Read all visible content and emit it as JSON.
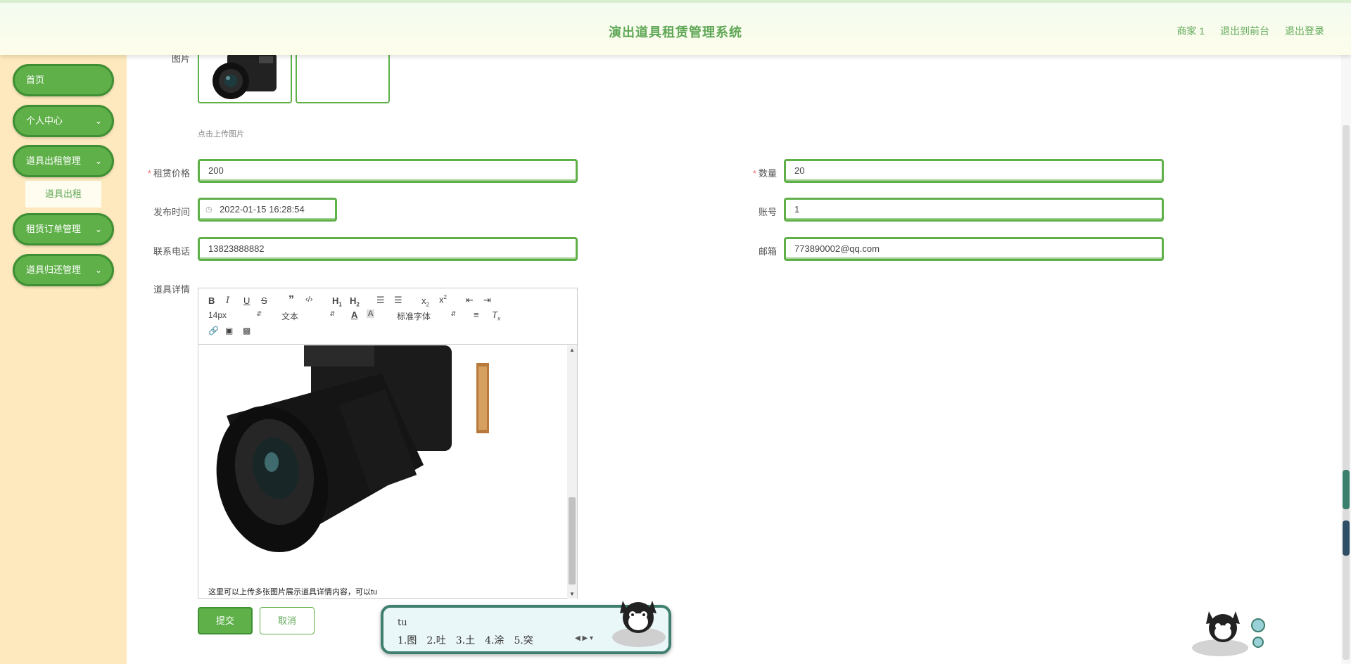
{
  "header": {
    "title": "演出道具租赁管理系统",
    "links": [
      "商家 1",
      "退出到前台",
      "退出登录"
    ]
  },
  "sidebar": {
    "items": [
      {
        "label": "首页",
        "has_chevron": false
      },
      {
        "label": "个人中心",
        "has_chevron": true
      },
      {
        "label": "道具出租管理",
        "has_chevron": true
      },
      {
        "label": "租赁订单管理",
        "has_chevron": true
      },
      {
        "label": "道具归还管理",
        "has_chevron": true
      }
    ],
    "submenu_label": "道具出租"
  },
  "form": {
    "image_label": "图片",
    "upload_hint": "点击上传图片",
    "price": {
      "label": "租赁价格",
      "value": "200",
      "required": true
    },
    "quantity": {
      "label": "数量",
      "value": "20",
      "required": true
    },
    "publish_time": {
      "label": "发布时间",
      "value": "2022-01-15 16:28:54"
    },
    "account": {
      "label": "账号",
      "value": "1"
    },
    "phone": {
      "label": "联系电话",
      "value": "13823888882"
    },
    "email": {
      "label": "邮箱",
      "value": "773890002@qq.com"
    },
    "details_label": "道具详情"
  },
  "editor": {
    "font_size": "14px",
    "header_select": "文本",
    "font_family": "标准字体",
    "body_text": "这里可以上传多张图片展示道具详情内容，可以tu"
  },
  "buttons": {
    "submit": "提交",
    "cancel": "取消"
  },
  "ime": {
    "composition": "tu",
    "candidates": [
      "1.图",
      "2.吐",
      "3.土",
      "4.涂",
      "5.突"
    ]
  },
  "colors": {
    "accent": "#5fb049",
    "accent_dark": "#3f8f34",
    "title_text": "#5fa756",
    "sidebar_bg": "#fde9bd"
  }
}
